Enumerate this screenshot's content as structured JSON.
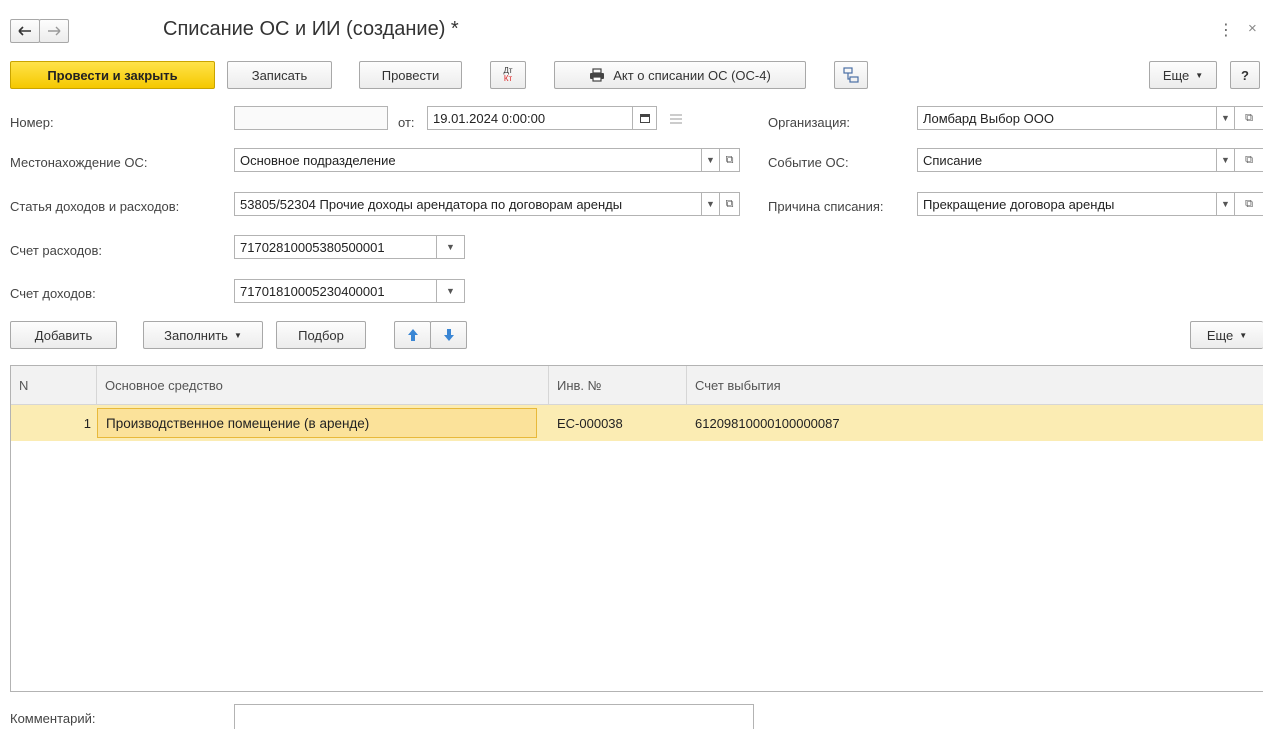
{
  "window": {
    "title": "Списание ОС и ИИ (создание) *"
  },
  "toolbar": {
    "post_close": "Провести и закрыть",
    "save": "Записать",
    "post": "Провести",
    "dtkt_dt": "Дт",
    "dtkt_kt": "Кт",
    "print_act": "Акт о списании ОС (ОС-4)",
    "more": "Еще",
    "help": "?"
  },
  "form": {
    "number_label": "Номер:",
    "number_value": "",
    "date_prefix": "от:",
    "date_value": "19.01.2024  0:00:00",
    "org_label": "Организация:",
    "org_value": "Ломбард Выбор ООО",
    "location_label": "Местонахождение ОС:",
    "location_value": "Основное подразделение",
    "event_label": "Событие ОС:",
    "event_value": "Списание",
    "item_label": "Статья доходов и расходов:",
    "item_value": "53805/52304 Прочие доходы арендатора по договорам аренды",
    "reason_label": "Причина списания:",
    "reason_value": "Прекращение договора аренды",
    "expense_label": "Счет расходов:",
    "expense_value": "71702810005380500001",
    "income_label": "Счет доходов:",
    "income_value": "71701810005230400001",
    "comment_label": "Комментарий:",
    "comment_value": ""
  },
  "table_toolbar": {
    "add": "Добавить",
    "fill": "Заполнить",
    "pick": "Подбор",
    "more": "Еще"
  },
  "table": {
    "headers": [
      "N",
      "Основное средство",
      "Инв. №",
      "Счет выбытия"
    ],
    "rows": [
      {
        "n": "1",
        "asset": "Производственное помещение (в аренде)",
        "inv": "ЕС-000038",
        "account": "61209810000100000087"
      }
    ]
  }
}
